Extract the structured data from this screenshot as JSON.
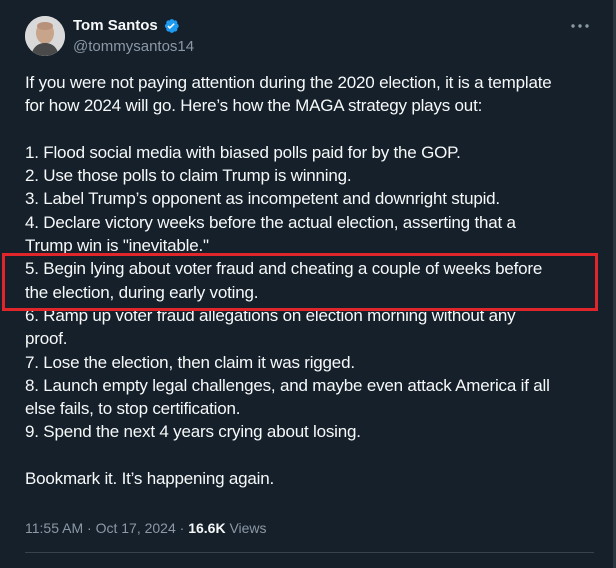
{
  "author": {
    "name": "Tom Santos",
    "handle": "@tommysantos14",
    "verified": true
  },
  "tweet": {
    "intro_lines": [
      "If you were not paying attention during the 2020 election, it is a template",
      "for how 2024 will go. Here’s how the MAGA strategy plays out:"
    ],
    "list_lines": [
      "1. Flood social media with biased polls paid for by the GOP.",
      "2. Use those polls to claim Trump is winning.",
      "3. Label Trump’s opponent as incompetent and downright stupid.",
      "4. Declare victory weeks before the actual election, asserting that a",
      "Trump win is \"inevitable.\"",
      "5. Begin lying about voter fraud and cheating a couple of weeks before",
      "the election, during early voting.",
      "6. Ramp up voter fraud allegations on election morning without any",
      "proof.",
      "7. Lose the election, then claim it was rigged.",
      "8. Launch empty legal challenges, and maybe even attack America if all",
      "else fails, to stop certification.",
      "9. Spend the next 4 years crying about losing."
    ],
    "closing": "Bookmark it. It’s happening again."
  },
  "meta": {
    "time": "11:55 AM",
    "separator": " · ",
    "date": "Oct 17, 2024",
    "views_count": "16.6K",
    "views_label": "Views"
  },
  "icons": {
    "verified": "verified-badge-icon",
    "more": "more-horizontal-icon"
  },
  "colors": {
    "background": "#15202b",
    "text": "#f7f9f9",
    "secondary_text": "#8b98a5",
    "verified": "#1d9bf0",
    "highlight": "#e0262b"
  }
}
